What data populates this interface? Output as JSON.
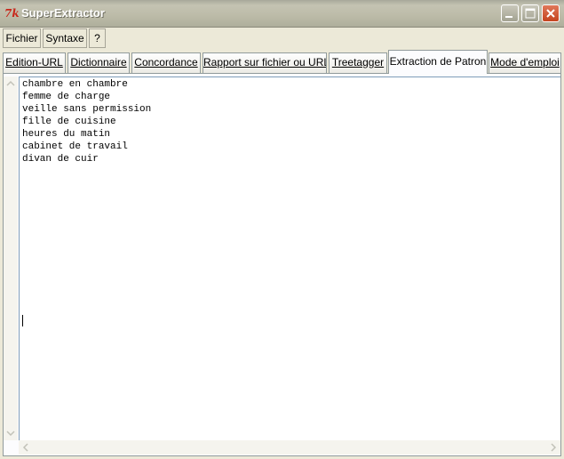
{
  "window": {
    "title": "SuperExtractor",
    "icon": "tk-feather-icon"
  },
  "menu": {
    "items": [
      "Fichier",
      "Syntaxe",
      "?"
    ]
  },
  "tabs": [
    {
      "label": "Edition-URL"
    },
    {
      "label": "Dictionnaire"
    },
    {
      "label": "Concordance"
    },
    {
      "label": "Rapport sur fichier ou URL"
    },
    {
      "label": "Treetagger"
    },
    {
      "label": "Extraction de Patron",
      "active": true
    },
    {
      "label": "Mode d'emploi"
    }
  ],
  "editor": {
    "lines": [
      "chambre en chambre",
      "femme de charge",
      "veille sans permission",
      "fille de cuisine",
      "heures du matin",
      "cabinet de travail",
      "divan de cuir"
    ]
  },
  "colors": {
    "title_bar": "#bcbba8",
    "close_button": "#c4441e",
    "window_bg": "#ece9d8"
  }
}
